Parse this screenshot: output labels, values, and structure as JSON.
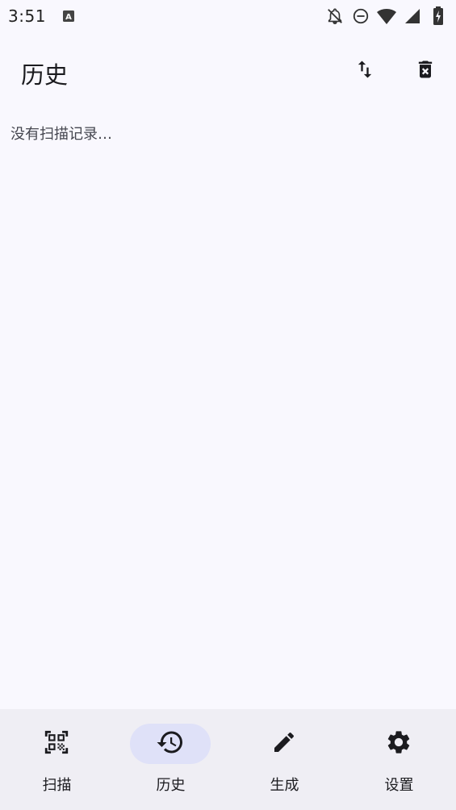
{
  "status_bar": {
    "time": "3:51",
    "left_icon": "a-notification-icon",
    "right_icons": [
      "notifications-off-icon",
      "do-not-disturb-icon",
      "wifi-icon",
      "cell-signal-icon",
      "battery-charging-icon"
    ]
  },
  "top_bar": {
    "title": "历史",
    "actions": [
      {
        "name": "sort",
        "icon": "swap-vertical-icon"
      },
      {
        "name": "delete",
        "icon": "delete-forever-icon"
      }
    ]
  },
  "content": {
    "empty_message": "没有扫描记录…"
  },
  "bottom_nav": {
    "items": [
      {
        "label": "扫描",
        "icon": "qr-code-scanner-icon",
        "active": false
      },
      {
        "label": "历史",
        "icon": "history-icon",
        "active": true
      },
      {
        "label": "生成",
        "icon": "edit-pencil-icon",
        "active": false
      },
      {
        "label": "设置",
        "icon": "settings-gear-icon",
        "active": false
      }
    ]
  },
  "colors": {
    "background": "#f9f8fe",
    "nav_background": "#efeef4",
    "active_indicator": "#dfe1f8",
    "text": "#1b1b1f",
    "secondary_text": "#45464f"
  }
}
